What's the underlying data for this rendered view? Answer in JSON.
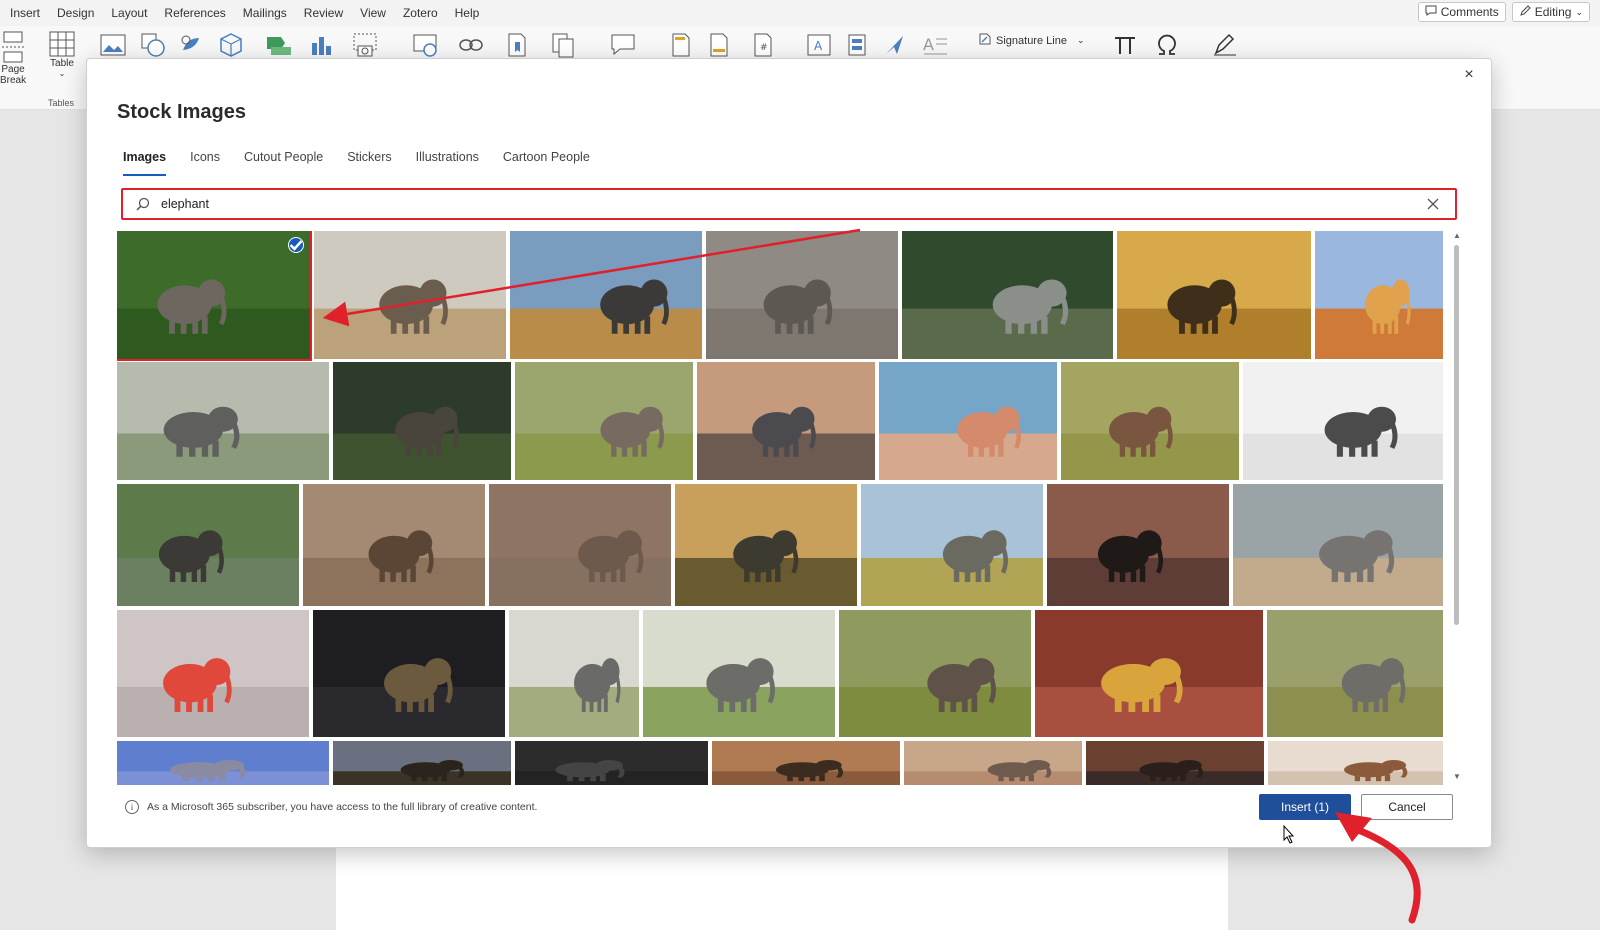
{
  "menu": {
    "items": [
      "Insert",
      "Design",
      "Layout",
      "References",
      "Mailings",
      "Review",
      "View",
      "Zotero",
      "Help"
    ],
    "active": "Insert",
    "comments_label": "Comments",
    "editing_label": "Editing"
  },
  "ribbon": {
    "page_break_line1": "Page",
    "page_break_line2": "Break",
    "table_label": "Table",
    "tables_group": "Tables",
    "signature_line": "Signature Line"
  },
  "dialog": {
    "title": "Stock Images",
    "close_glyph": "×",
    "tabs": [
      "Images",
      "Icons",
      "Cutout People",
      "Stickers",
      "Illustrations",
      "Cartoon People"
    ],
    "active_tab": "Images",
    "search_value": "elephant",
    "footer_note": "As a Microsoft 365 subscriber, you have access to the full library of creative content.",
    "insert_label": "Insert (1)",
    "cancel_label": "Cancel",
    "selected_index": 0
  },
  "colors": {
    "accent": "#185abd",
    "primary_button": "#1f4e9b",
    "annotation_red": "#e0202b"
  },
  "images": {
    "rows": [
      [
        {
          "subject": "elephant-in-jungle",
          "sky": "#3d6b2a",
          "ground": "#2f5a1f",
          "elephant": "#6d6760"
        },
        {
          "subject": "elephant-in-grass",
          "sky": "#cfcac0",
          "ground": "#bba27b",
          "elephant": "#6b5d4e"
        },
        {
          "subject": "elephant-savanna",
          "sky": "#7a9cbf",
          "ground": "#b98c4a",
          "elephant": "#3c3a38"
        },
        {
          "subject": "elephant-skin-eye",
          "sky": "#8f8a83",
          "ground": "#7d776f",
          "elephant": "#5d5852"
        },
        {
          "subject": "elephant-trunk-hand",
          "sky": "#2f4a2c",
          "ground": "#5a6b4c",
          "elephant": "#8a8f8a"
        },
        {
          "subject": "acacia-herd",
          "sky": "#d8a94a",
          "ground": "#b07f2b",
          "elephant": "#3e2e1a"
        },
        {
          "subject": "ganesha-statue",
          "sky": "#9ab7e0",
          "ground": "#d07a3a",
          "elephant": "#e0a24d"
        }
      ],
      [
        {
          "subject": "elephant-trunk-touch",
          "sky": "#b5bcae",
          "ground": "#8a9a7a",
          "elephant": "#5f605d"
        },
        {
          "subject": "herd-in-forest",
          "sky": "#2d3b2a",
          "ground": "#3f5330",
          "elephant": "#4a453c"
        },
        {
          "subject": "mother-and-calf",
          "sky": "#9aa66e",
          "ground": "#8b9a4c",
          "elephant": "#776a61"
        },
        {
          "subject": "elephant-sunset",
          "sky": "#c69a7d",
          "ground": "#6d5b52",
          "elephant": "#4b4b4f"
        },
        {
          "subject": "ganesha-figurine",
          "sky": "#75a6c8",
          "ground": "#d6a98f",
          "elephant": "#d48a6b"
        },
        {
          "subject": "elephants-field",
          "sky": "#a3a561",
          "ground": "#94974a",
          "elephant": "#7a5540"
        },
        {
          "subject": "elephant-bw",
          "sky": "#f1f1f1",
          "ground": "#e2e2e2",
          "elephant": "#4b4b4b"
        }
      ],
      [
        {
          "subject": "elephants-river",
          "sky": "#5d7b4a",
          "ground": "#6a8060",
          "elephant": "#3c3a36"
        },
        {
          "subject": "wood-block-stamps",
          "sky": "#a48a72",
          "ground": "#8d735c",
          "elephant": "#5b4635"
        },
        {
          "subject": "herd-close",
          "sky": "#8e7462",
          "ground": "#86705f",
          "elephant": "#6e5a4d"
        },
        {
          "subject": "acacia-trumpet",
          "sky": "#c9a05b",
          "ground": "#6a5a2f",
          "elephant": "#3d3a30"
        },
        {
          "subject": "elephant-bush",
          "sky": "#aac2d8",
          "ground": "#b2a455",
          "elephant": "#6b6a60"
        },
        {
          "subject": "reflection-sunset",
          "sky": "#8a5a4b",
          "ground": "#5e3d37",
          "elephant": "#1f1a18"
        },
        {
          "subject": "mountain-desert",
          "sky": "#9aa3a6",
          "ground": "#c1ab8c",
          "elephant": "#777370"
        }
      ],
      [
        {
          "subject": "toy-animals",
          "sky": "#cfc5c4",
          "ground": "#b9b0af",
          "elephant": "#e0483b"
        },
        {
          "subject": "dark-ganesha",
          "sky": "#1e1e22",
          "ground": "#2a2a2e",
          "elephant": "#6b5a3e"
        },
        {
          "subject": "misty-calf",
          "sky": "#d8d8d0",
          "ground": "#a1ad7f",
          "elephant": "#6a6a68"
        },
        {
          "subject": "misty-pair",
          "sky": "#d7dccd",
          "ground": "#8aa35e",
          "elephant": "#6c6d69"
        },
        {
          "subject": "elephant-frontal",
          "sky": "#8e9a5e",
          "ground": "#7e8c3f",
          "elephant": "#5f5249"
        },
        {
          "subject": "golden-ganesha-hands",
          "sky": "#8a3a2c",
          "ground": "#a94f3f",
          "elephant": "#d9a43b"
        },
        {
          "subject": "calf-grass",
          "sky": "#9a9f6b",
          "ground": "#8d8f4e",
          "elephant": "#6f6d68"
        }
      ],
      [
        {
          "subject": "blue-sky",
          "sky": "#5f7ed0",
          "ground": "#7c90d6",
          "elephant": "#8a8aa0"
        },
        {
          "subject": "dusk-trees",
          "sky": "#6a7080",
          "ground": "#3a3326",
          "elephant": "#2a241d"
        },
        {
          "subject": "dark-silhouette",
          "sky": "#2c2c2c",
          "ground": "#232323",
          "elephant": "#444444"
        },
        {
          "subject": "golden-dusk",
          "sky": "#b07b52",
          "ground": "#8a5a3d",
          "elephant": "#3c2c20"
        },
        {
          "subject": "herd-road",
          "sky": "#c7a68a",
          "ground": "#b58c6f",
          "elephant": "#6e5b4e"
        },
        {
          "subject": "orange-sunset",
          "sky": "#6a4030",
          "ground": "#3a2a28",
          "elephant": "#2a1f1a"
        },
        {
          "subject": "people-elephant",
          "sky": "#e8dcd0",
          "ground": "#d4c2b0",
          "elephant": "#8a5a3a"
        }
      ]
    ]
  }
}
